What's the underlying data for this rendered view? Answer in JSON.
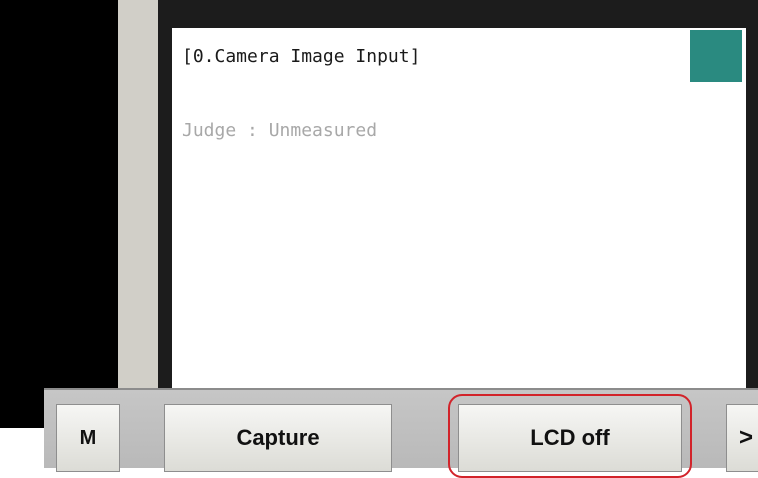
{
  "panel": {
    "title": "[0.Camera Image Input]",
    "judge": "Judge : Unmeasured",
    "status_color": "#2a8a80"
  },
  "toolbar": {
    "m_label": "M",
    "capture_label": "Capture",
    "lcd_off_label": "LCD off",
    "more_label": ">",
    "highlight_color": "#d2232a"
  }
}
